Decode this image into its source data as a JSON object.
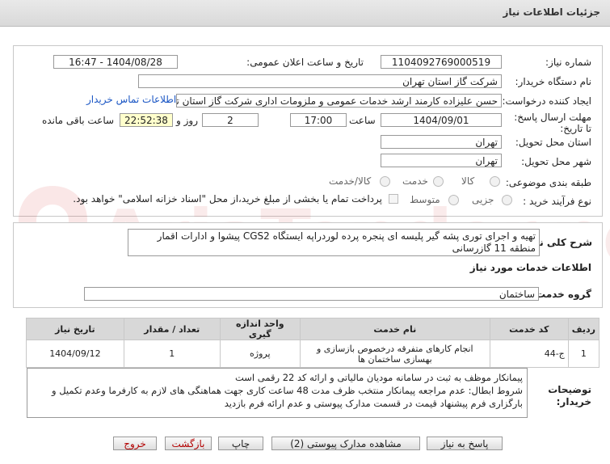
{
  "window": {
    "title": "جزئیات اطلاعات نیاز"
  },
  "watermark": {
    "text": "AriaTender.net"
  },
  "fields": {
    "need_number": {
      "label": "شماره نیاز:",
      "value": "1104092769000519"
    },
    "announce_datetime": {
      "label": "تاریخ و ساعت اعلان عمومی:",
      "value": "1404/08/28 - 16:47"
    },
    "buyer_org": {
      "label": "نام دستگاه خریدار:",
      "value": "شرکت گاز استان تهران"
    },
    "requester": {
      "label": "ایجاد کننده درخواست:",
      "value": "حسن علیزاده کارمند ارشد خدمات عمومی و ملزومات اداری شرکت گاز استان تهران"
    },
    "buyer_contact_link": "اطلاعات تماس خریدار",
    "deadline": {
      "label": "مهلت ارسال پاسخ: تا تاریخ:",
      "date": "1404/09/01",
      "time_label": "ساعت",
      "time": "17:00",
      "days": "2",
      "days_label": "روز و",
      "remaining": "22:52:38",
      "remaining_label": "ساعت باقی مانده"
    },
    "delivery_province": {
      "label": "استان محل تحویل:",
      "value": "تهران"
    },
    "delivery_city": {
      "label": "شهر محل تحویل:",
      "value": "تهران"
    },
    "category": {
      "label": "طبقه بندی موضوعی:",
      "options": [
        "کالا",
        "خدمت",
        "کالا/خدمت"
      ]
    },
    "process_type": {
      "label": "نوع فرآیند خرید :",
      "options": [
        "جزیی",
        "متوسط"
      ],
      "payment_note": "پرداخت تمام یا بخشی از مبلغ خرید،از محل \"اسناد خزانه اسلامی\" خواهد بود."
    }
  },
  "description": {
    "label": "شرح کلی نیاز:",
    "value": "تهیه و اجرای  توری پشه گیر پلیسه ای پنجره پرده لوردراپه ایستگاه CGS2 پیشوا و ادارات اقمار منطقه 11 گازرسانی"
  },
  "services": {
    "section_title": "اطلاعات خدمات مورد نیاز",
    "group_label": "گروه خدمت:",
    "group_value": "ساختمان",
    "columns": [
      "ردیف",
      "کد خدمت",
      "نام خدمت",
      "واحد اندازه گیری",
      "تعداد / مقدار",
      "تاریخ نیاز"
    ],
    "rows": [
      [
        "1",
        "ج-44",
        "انجام کارهای متفرقه درخصوص بازسازی و بهسازی ساختمان ها",
        "پروژه",
        "1",
        "1404/09/12"
      ]
    ]
  },
  "buyer_notes": {
    "label": "توضیحات خریدار:",
    "lines": [
      "پیمانکار موظف به ثبت در سامانه مودیان مالیاتی و ارائه کد 22 رقمی است",
      "شروط ابطال: عدم مراجعه پیمانکار منتخب ظرف مدت 48 ساعت کاری جهت هماهنگی های لازم به کارفرما وعدم تکمیل و",
      "بارگزاری فرم پیشنهاد قیمت در قسمت مدارک پیوستی و عدم ارائه فرم بازدید"
    ]
  },
  "buttons": {
    "reply": "پاسخ به نیاز",
    "attachments": "مشاهده مدارک پیوستی (2)",
    "print": "چاپ",
    "back": "بازگشت",
    "exit": "خروج"
  }
}
